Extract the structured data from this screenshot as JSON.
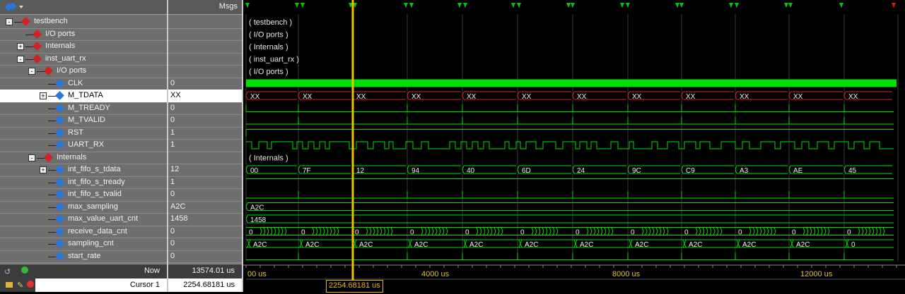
{
  "header": {
    "msgs_label": "Msgs"
  },
  "signals": [
    {
      "name": "testbench",
      "msg": "",
      "wave_label": "( testbench )",
      "indent": 0,
      "type": "group",
      "exp": "-"
    },
    {
      "name": "I/O ports",
      "msg": "",
      "wave_label": "( I/O ports )",
      "indent": 1,
      "type": "group",
      "exp": ""
    },
    {
      "name": "Internals",
      "msg": "",
      "wave_label": "( Internals )",
      "indent": 1,
      "type": "group",
      "exp": "+"
    },
    {
      "name": "inst_uart_rx",
      "msg": "",
      "wave_label": "( inst_uart_rx )",
      "indent": 1,
      "type": "group",
      "exp": "-"
    },
    {
      "name": "I/O ports",
      "msg": "",
      "wave_label": "( I/O ports )",
      "indent": 2,
      "type": "group",
      "exp": "-"
    },
    {
      "name": "CLK",
      "msg": "0",
      "indent": 3,
      "type": "signal",
      "exp": ""
    },
    {
      "name": "M_TDATA",
      "msg": "XX",
      "indent": 3,
      "type": "signal",
      "exp": "+",
      "selected": true
    },
    {
      "name": "M_TREADY",
      "msg": "0",
      "indent": 3,
      "type": "signal",
      "exp": ""
    },
    {
      "name": "M_TVALID",
      "msg": "0",
      "indent": 3,
      "type": "signal",
      "exp": ""
    },
    {
      "name": "RST",
      "msg": "1",
      "indent": 3,
      "type": "signal",
      "exp": ""
    },
    {
      "name": "UART_RX",
      "msg": "1",
      "indent": 3,
      "type": "signal",
      "exp": ""
    },
    {
      "name": "Internals",
      "msg": "",
      "wave_label": "( Internals )",
      "indent": 2,
      "type": "group",
      "exp": "-"
    },
    {
      "name": "int_fifo_s_tdata",
      "msg": "12",
      "indent": 3,
      "type": "signal",
      "exp": "+"
    },
    {
      "name": "int_fifo_s_tready",
      "msg": "1",
      "indent": 3,
      "type": "signal",
      "exp": ""
    },
    {
      "name": "int_fifo_s_tvalid",
      "msg": "0",
      "indent": 3,
      "type": "signal",
      "exp": ""
    },
    {
      "name": "max_sampling",
      "msg": "A2C",
      "indent": 3,
      "type": "signal",
      "exp": ""
    },
    {
      "name": "max_value_uart_cnt",
      "msg": "1458",
      "indent": 3,
      "type": "signal",
      "exp": ""
    },
    {
      "name": "receive_data_cnt",
      "msg": "0",
      "indent": 3,
      "type": "signal",
      "exp": ""
    },
    {
      "name": "sampling_cnt",
      "msg": "0",
      "indent": 3,
      "type": "signal",
      "exp": ""
    },
    {
      "name": "start_rate",
      "msg": "0",
      "indent": 3,
      "type": "signal",
      "exp": ""
    }
  ],
  "waves": {
    "mtdata_values": [
      "XX",
      "XX",
      "XX",
      "XX",
      "XX",
      "XX",
      "XX",
      "XX",
      "XX",
      "XX",
      "XX",
      "XX"
    ],
    "tdata_values": [
      "00",
      "7F",
      "12",
      "94",
      "40",
      "6D",
      "24",
      "9C",
      "C9",
      "A3",
      "AE",
      "45"
    ],
    "max_sampling": "A2C",
    "max_value_uart_cnt": "1458",
    "receive_data_cnt_value": "0",
    "sampling_cnt_value": "A2C",
    "sampling_cnt_tail": "0"
  },
  "footer": {
    "now_label": "Now",
    "now_value": "13574.01 us",
    "cursor_label": "Cursor 1",
    "cursor_value": "2254.68181 us",
    "cursor_box": "2254.68181 us",
    "axis_labels": [
      "00 us",
      "4000 us",
      "8000 us",
      "12000 us"
    ]
  },
  "colors": {
    "wave_green": "#00e000",
    "xx_red": "#e02020",
    "cursor_yellow": "#f0c000",
    "marker_green": "#10c010",
    "marker_red": "#e01010"
  },
  "icons": {
    "toolbar": "wave-dropdown-icon",
    "group": "red-diamond-icon",
    "signal": "blue-diamond-icon"
  }
}
